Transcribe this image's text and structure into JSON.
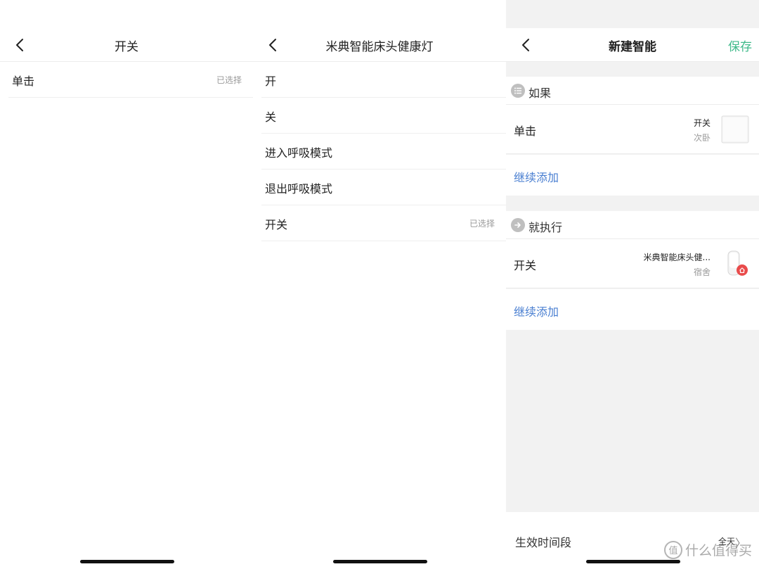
{
  "panel1": {
    "title": "开关",
    "items": [
      {
        "label": "单击",
        "tag": "已选择"
      }
    ]
  },
  "panel2": {
    "title": "米典智能床头健康灯",
    "items": [
      {
        "label": "开",
        "tag": ""
      },
      {
        "label": "关",
        "tag": ""
      },
      {
        "label": "进入呼吸模式",
        "tag": ""
      },
      {
        "label": "退出呼吸模式",
        "tag": ""
      },
      {
        "label": "开关",
        "tag": "已选择"
      }
    ]
  },
  "panel3": {
    "title": "新建智能",
    "save_label": "保存",
    "if_section": {
      "title": "如果",
      "condition": {
        "label": "单击",
        "device": "开关",
        "room": "次卧"
      },
      "add_label": "继续添加"
    },
    "then_section": {
      "title": "就执行",
      "action": {
        "label": "开关",
        "device": "米典智能床头健...",
        "room": "宿舍"
      },
      "add_label": "继续添加"
    },
    "effective_period": {
      "label": "生效时间段",
      "value": "全天",
      "chevron": "〉"
    }
  },
  "watermark": {
    "badge": "值",
    "text": "什么值得买"
  },
  "colors": {
    "accent_green": "#3fba8a",
    "link_blue": "#4a7fd1",
    "badge_red": "#e94b4b"
  },
  "icons": [
    "back-icon",
    "list-icon",
    "arrow-right-icon",
    "switch-device-icon",
    "lamp-device-icon",
    "home-badge-icon"
  ]
}
